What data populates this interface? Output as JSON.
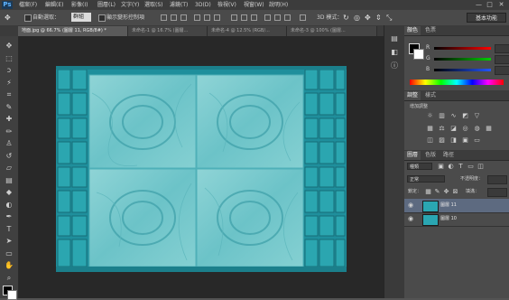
{
  "app": {
    "logo": "Ps"
  },
  "menu": [
    "檔案(F)",
    "編輯(E)",
    "影像(I)",
    "圖層(L)",
    "文字(Y)",
    "選取(S)",
    "濾鏡(T)",
    "3D(D)",
    "檢視(V)",
    "視窗(W)",
    "說明(H)"
  ],
  "window_controls": [
    "—",
    "□",
    "✕"
  ],
  "options": {
    "auto_select_label": "自動選取：",
    "auto_select_value": "群組",
    "show_transform_label": "顯示變形控制項",
    "mode_3d_label": "3D 模式：",
    "workspace": "基本功能"
  },
  "tabs": [
    {
      "label": "地面.jpg @ 66.7% (圖層 11, RGB/8#) *",
      "active": true
    },
    {
      "label": "未命名-1 @ 16.7% (圖層...",
      "active": false
    },
    {
      "label": "未命名-4 @ 12.5% (RGB/...",
      "active": false
    },
    {
      "label": "未命名-3 @ 100% (圖層...",
      "active": false
    }
  ],
  "tools": [
    {
      "icon": "move-tool-icon",
      "glyph": "✥"
    },
    {
      "icon": "marquee-tool-icon",
      "glyph": "⬚"
    },
    {
      "icon": "lasso-tool-icon",
      "glyph": "ↄ"
    },
    {
      "icon": "magic-wand-icon",
      "glyph": "⚡"
    },
    {
      "icon": "crop-tool-icon",
      "glyph": "⌗"
    },
    {
      "icon": "eyedropper-icon",
      "glyph": "✎"
    },
    {
      "icon": "healing-brush-icon",
      "glyph": "✚"
    },
    {
      "icon": "brush-tool-icon",
      "glyph": "✏"
    },
    {
      "icon": "clone-stamp-icon",
      "glyph": "♙"
    },
    {
      "icon": "history-brush-icon",
      "glyph": "↺"
    },
    {
      "icon": "eraser-icon",
      "glyph": "▱"
    },
    {
      "icon": "gradient-tool-icon",
      "glyph": "▤"
    },
    {
      "icon": "blur-tool-icon",
      "glyph": "◆"
    },
    {
      "icon": "dodge-tool-icon",
      "glyph": "◐"
    },
    {
      "icon": "pen-tool-icon",
      "glyph": "✒"
    },
    {
      "icon": "type-tool-icon",
      "glyph": "T"
    },
    {
      "icon": "path-selection-icon",
      "glyph": "➤"
    },
    {
      "icon": "shape-tool-icon",
      "glyph": "▭"
    },
    {
      "icon": "hand-tool-icon",
      "glyph": "✋"
    },
    {
      "icon": "zoom-tool-icon",
      "glyph": "⌕"
    }
  ],
  "panels": {
    "color_tabs": [
      "顏色",
      "色票"
    ],
    "rgb_labels": [
      "R",
      "G",
      "B"
    ],
    "adjust_tabs": [
      "調整",
      "樣式"
    ],
    "adjust_title": "增加調整",
    "layers_tabs": [
      "圖層",
      "色版",
      "路徑"
    ],
    "kind_label": "種類",
    "blend_mode": "正常",
    "opacity_label": "不透明度：",
    "lock_label": "鎖定：",
    "fill_label": "填滿：",
    "layers": [
      {
        "name": "圖層 11",
        "selected": true
      },
      {
        "name": "圖層 10",
        "selected": false
      }
    ]
  },
  "colors": {
    "slider_r": "#d22b2b",
    "slider_g": "#2bb32b",
    "slider_b": "#2b5bd2",
    "texture": "#2aa6b2"
  }
}
